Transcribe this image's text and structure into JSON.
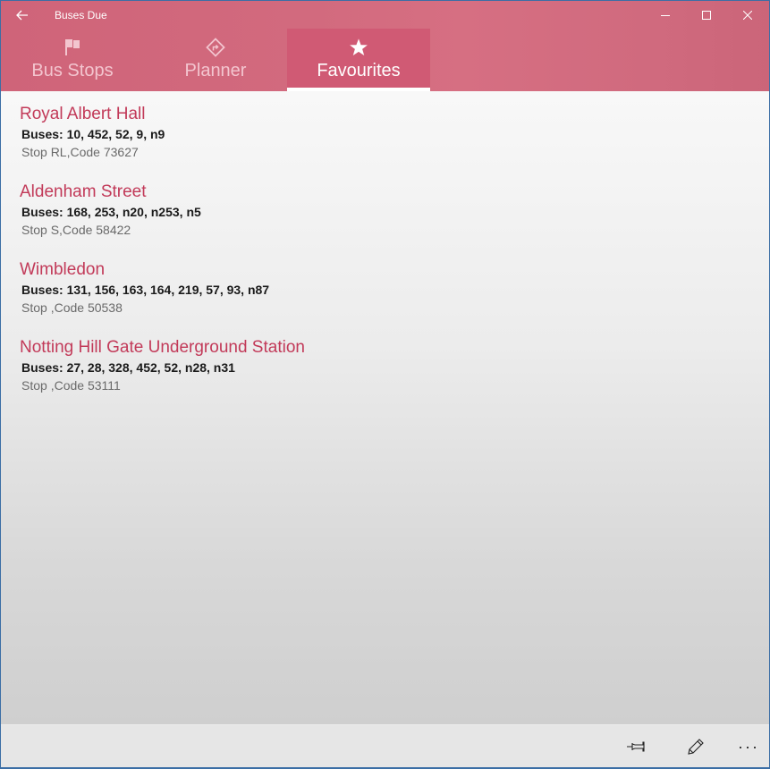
{
  "window": {
    "title": "Buses Due",
    "controls": {
      "back": "back-arrow-icon",
      "minimize": "minimize-icon",
      "maximize": "maximize-icon",
      "close": "close-icon"
    }
  },
  "tabs": [
    {
      "label": "Bus Stops",
      "icon": "flag-icon",
      "selected": false
    },
    {
      "label": "Planner",
      "icon": "directions-icon",
      "selected": false
    },
    {
      "label": "Favourites",
      "icon": "star-icon",
      "selected": true
    }
  ],
  "favourites": [
    {
      "name": "Royal Albert Hall",
      "buses": "Buses: 10, 452, 52, 9, n9",
      "code": "Stop RL,Code 73627"
    },
    {
      "name": "Aldenham Street",
      "buses": "Buses: 168, 253, n20, n253, n5",
      "code": "Stop S,Code 58422"
    },
    {
      "name": "Wimbledon",
      "buses": "Buses: 131, 156, 163, 164, 219, 57, 93, n87",
      "code": "Stop ,Code 50538"
    },
    {
      "name": "Notting Hill Gate Underground Station",
      "buses": "Buses: 27, 28, 328, 452, 52, n28, n31",
      "code": "Stop ,Code 53111"
    }
  ],
  "appbar": {
    "buttons": [
      {
        "name": "pin",
        "icon": "pin-icon"
      },
      {
        "name": "edit",
        "icon": "pencil-icon"
      },
      {
        "name": "more",
        "icon": "more-icon",
        "glyph": "···"
      }
    ]
  },
  "colors": {
    "accent": "#d26a7e",
    "selected_tab": "#d05a74",
    "stop_name": "#c23a59"
  }
}
